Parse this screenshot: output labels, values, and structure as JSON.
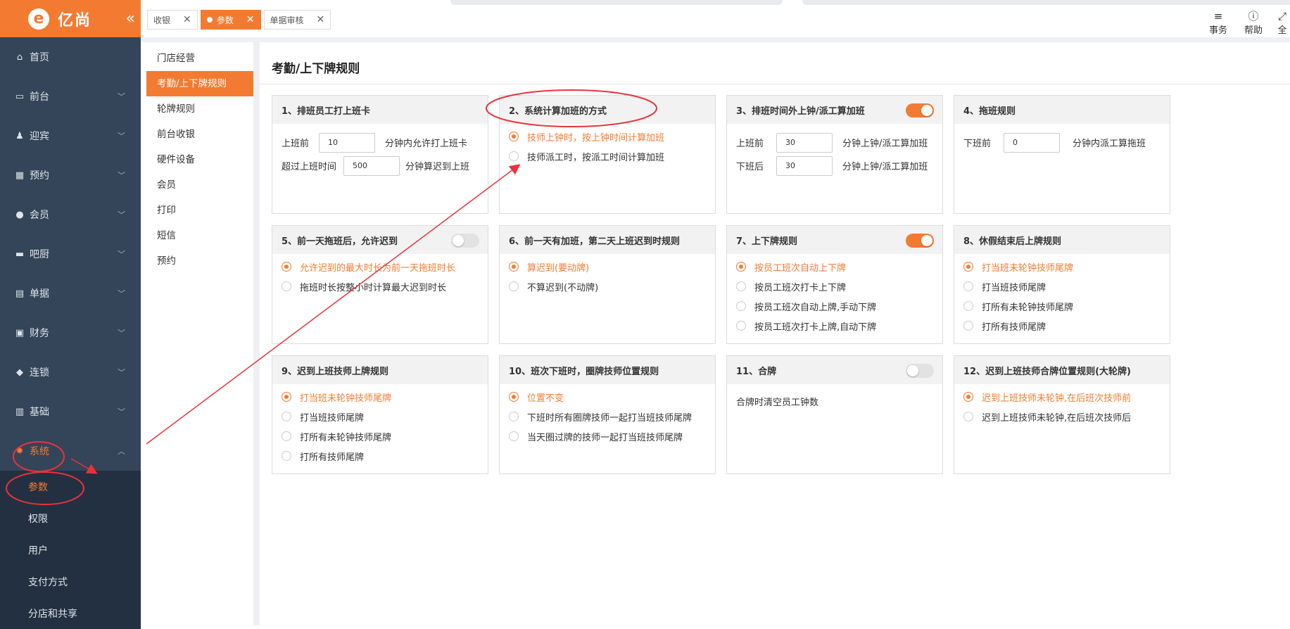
{
  "colors": {
    "accent": "#f37b31",
    "sidebar_bg": "#344559",
    "sidebar_sub_bg": "#233041",
    "annotation": "#e8333b"
  },
  "app": {
    "logo_text": "亿尚"
  },
  "sidebar": {
    "items": [
      {
        "label": "首页",
        "icon": "home-icon"
      },
      {
        "label": "前台",
        "icon": "monitor-icon"
      },
      {
        "label": "迎宾",
        "icon": "user-icon"
      },
      {
        "label": "预约",
        "icon": "calendar-icon"
      },
      {
        "label": "会员",
        "icon": "person-icon"
      },
      {
        "label": "吧厨",
        "icon": "bar-icon"
      },
      {
        "label": "单据",
        "icon": "clipboard-icon"
      },
      {
        "label": "财务",
        "icon": "wallet-icon"
      },
      {
        "label": "连锁",
        "icon": "cube-icon"
      },
      {
        "label": "基础",
        "icon": "database-icon"
      },
      {
        "label": "系统",
        "icon": "gear-icon"
      }
    ],
    "sub_items": [
      {
        "label": "参数"
      },
      {
        "label": "权限"
      },
      {
        "label": "用户"
      },
      {
        "label": "支付方式"
      },
      {
        "label": "分店和共享"
      }
    ]
  },
  "tabs": [
    {
      "label": "收银"
    },
    {
      "label": "参数"
    },
    {
      "label": "单据审核"
    }
  ],
  "top_actions": [
    {
      "label": "事务",
      "icon": "menu-icon"
    },
    {
      "label": "帮助",
      "icon": "help-icon"
    },
    {
      "label": "全",
      "icon": "fullscreen-icon"
    }
  ],
  "settings_nav": [
    {
      "label": "门店经营"
    },
    {
      "label": "考勤/上下牌规则"
    },
    {
      "label": "轮牌规则"
    },
    {
      "label": "前台收银"
    },
    {
      "label": "硬件设备"
    },
    {
      "label": "会员"
    },
    {
      "label": "打印"
    },
    {
      "label": "短信"
    },
    {
      "label": "预约"
    }
  ],
  "page_title": "考勤/上下牌规则",
  "cards": {
    "c1": {
      "title": "1、排班员工打上班卡",
      "r1": {
        "pre": "上班前",
        "value": "10",
        "post": "分钟内允许打上班卡"
      },
      "r2": {
        "pre": "超过上班时间",
        "value": "500",
        "post": "分钟算迟到上班"
      }
    },
    "c2": {
      "title": "2、系统计算加班的方式",
      "o1": "技师上钟时，按上钟时间计算加班",
      "o2": "技师派工时，按派工时间计算加班"
    },
    "c3": {
      "title": "3、排班时间外上钟/派工算加班",
      "toggle": "on",
      "r1": {
        "pre": "上班前",
        "value": "30",
        "post": "分钟上钟/派工算加班"
      },
      "r2": {
        "pre": "下班后",
        "value": "30",
        "post": "分钟上钟/派工算加班"
      }
    },
    "c4": {
      "title": "4、拖班规则",
      "r1": {
        "pre": "下班前",
        "value": "0",
        "post": "分钟内派工算拖班"
      }
    },
    "c5": {
      "title": "5、前一天拖班后，允许迟到",
      "toggle": "off",
      "o1": "允许迟到的最大时长为前一天拖班时长",
      "o2": "拖班时长按整小时计算最大迟到时长"
    },
    "c6": {
      "title": "6、前一天有加班，第二天上班迟到时规则",
      "o1": "算迟到(要动牌)",
      "o2": "不算迟到(不动牌)"
    },
    "c7": {
      "title": "7、上下牌规则",
      "toggle": "on",
      "o1": "按员工班次自动上下牌",
      "o2": "按员工班次打卡上下牌",
      "o3": "按员工班次自动上牌,手动下牌",
      "o4": "按员工班次打卡上牌,自动下牌"
    },
    "c8": {
      "title": "8、休假结束后上牌规则",
      "o1": "打当班未轮钟技师尾牌",
      "o2": "打当班技师尾牌",
      "o3": "打所有未轮钟技师尾牌",
      "o4": "打所有技师尾牌"
    },
    "c9": {
      "title": "9、迟到上班技师上牌规则",
      "o1": "打当班未轮钟技师尾牌",
      "o2": "打当班技师尾牌",
      "o3": "打所有未轮钟技师尾牌",
      "o4": "打所有技师尾牌"
    },
    "c10": {
      "title": "10、班次下班时，圈牌技师位置规则",
      "o1": "位置不变",
      "o2": "下班时所有圈牌技师一起打当班技师尾牌",
      "o3": "当天圈过牌的技师一起打当班技师尾牌"
    },
    "c11": {
      "title": "11、合牌",
      "toggle": "off",
      "text": "合牌时清空员工钟数"
    },
    "c12": {
      "title": "12、迟到上班技师合牌位置规则(大轮牌)",
      "o1": "迟到上班技师未轮钟,在后班次技师前",
      "o2": "迟到上班技师未轮钟,在后班次技师后"
    }
  }
}
